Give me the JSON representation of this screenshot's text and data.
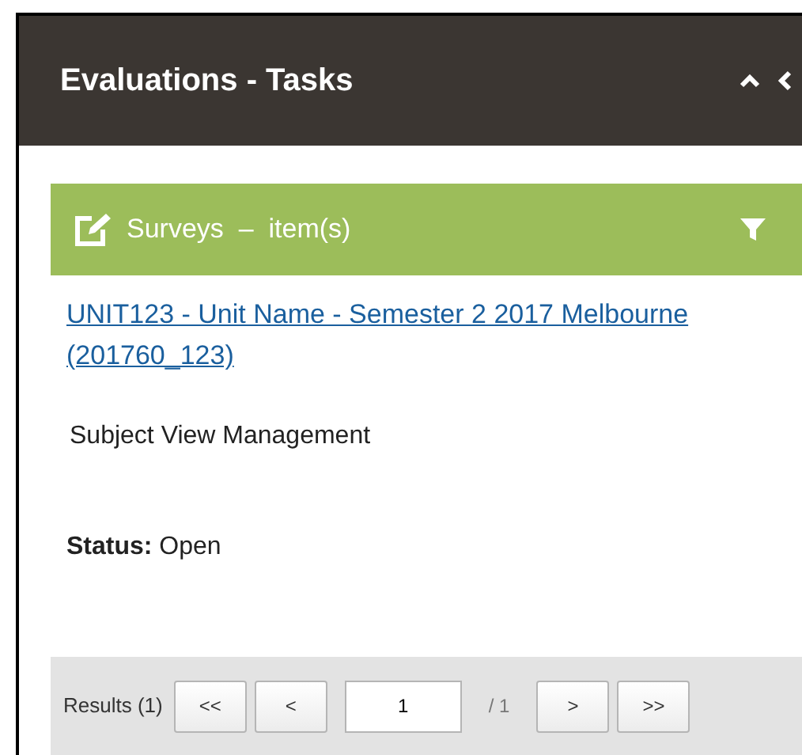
{
  "panel": {
    "title": "Evaluations - Tasks"
  },
  "section": {
    "title": "Surveys  –  item(s)"
  },
  "item": {
    "link": "UNIT123 - Unit Name - Semester 2 2017 Melbourne (201760_123)",
    "subtitle": "Subject View Management",
    "status": "**Status:** Open"
  },
  "pager": {
    "results": "Results (1)",
    "first": "<<",
    "prev": "<",
    "page": "1",
    "total": "/ 1",
    "next": ">",
    "last": ">>"
  }
}
